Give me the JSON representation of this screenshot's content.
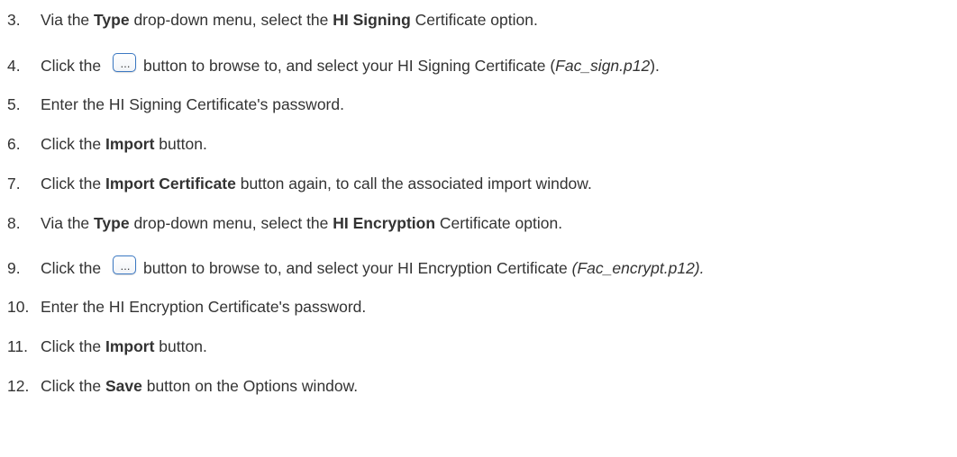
{
  "steps": [
    {
      "num": "3.",
      "parts": [
        "Via the ",
        "Type",
        " drop-down menu, select the ",
        "HI Signing",
        " Certificate option."
      ]
    },
    {
      "num": "4.",
      "parts": [
        "Click the ",
        "button to browse to, and select your HI Signing Certificate (",
        "Fac_sign.p12",
        ")."
      ],
      "browse_glyph": "…"
    },
    {
      "num": "5.",
      "parts": [
        "Enter the HI Signing Certificate's password."
      ]
    },
    {
      "num": "6.",
      "parts": [
        "Click the ",
        "Import",
        " button."
      ]
    },
    {
      "num": "7.",
      "parts": [
        "Click the ",
        "Import Certificate",
        " button again, to call the associated import window."
      ]
    },
    {
      "num": "8.",
      "parts": [
        "Via the ",
        "Type",
        " drop-down menu, select the ",
        "HI Encryption",
        " Certificate option."
      ]
    },
    {
      "num": "9.",
      "parts": [
        "Click the ",
        "button to browse to, and select your HI Encryption Certificate ",
        "(Fac_encrypt.p12)."
      ],
      "browse_glyph": "…"
    },
    {
      "num": "10.",
      "parts": [
        "Enter the HI Encryption Certificate's password."
      ]
    },
    {
      "num": "11.",
      "parts": [
        "Click the ",
        "Import",
        " button."
      ]
    },
    {
      "num": "12.",
      "parts": [
        "Click the ",
        "Save",
        " button on the Options window."
      ]
    }
  ],
  "browse_icon": "browse-ellipsis-icon",
  "colors": {
    "text": "#333333",
    "icon_border": "#3b78c2"
  }
}
